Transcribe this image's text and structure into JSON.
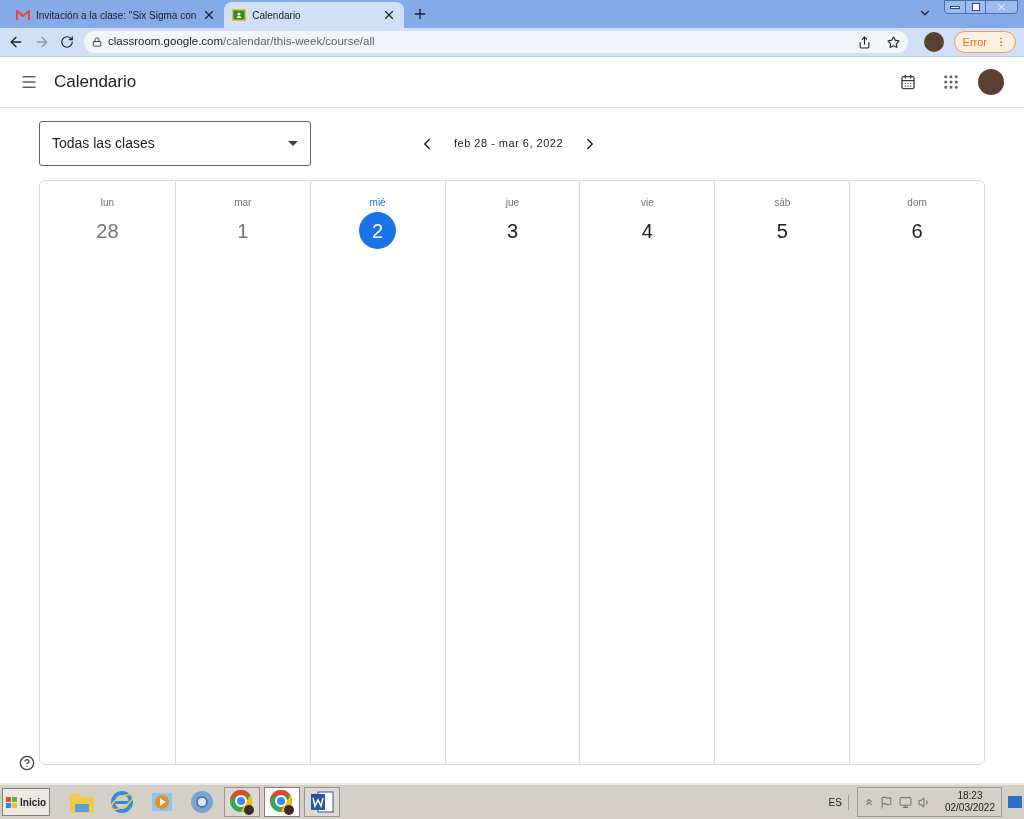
{
  "browser": {
    "tabs": [
      {
        "title": "Invitación a la clase: \"Six Sigma con",
        "kind": "mail",
        "selected": false
      },
      {
        "title": "Calendario",
        "kind": "classroom",
        "selected": true
      }
    ],
    "url_host": "classroom.google.com",
    "url_path": "/calendar/this-week/course/all",
    "profile_button": "Error"
  },
  "app": {
    "title": "Calendario"
  },
  "class_filter": {
    "value": "Todas las clases"
  },
  "week_range": "feb 28 - mar 6, 2022",
  "days": [
    {
      "weekday": "lun",
      "date": "28",
      "selected": false,
      "past": true
    },
    {
      "weekday": "mar",
      "date": "1",
      "selected": false,
      "past": true
    },
    {
      "weekday": "mié",
      "date": "2",
      "selected": true,
      "past": false
    },
    {
      "weekday": "jue",
      "date": "3",
      "selected": false,
      "past": false
    },
    {
      "weekday": "vie",
      "date": "4",
      "selected": false,
      "past": false
    },
    {
      "weekday": "sáb",
      "date": "5",
      "selected": false,
      "past": false
    },
    {
      "weekday": "dom",
      "date": "6",
      "selected": false,
      "past": false
    }
  ],
  "taskbar": {
    "start": "Inicio",
    "apps": [
      {
        "kind": "folder",
        "selected": false
      },
      {
        "kind": "ie",
        "selected": false
      },
      {
        "kind": "media",
        "selected": false
      },
      {
        "kind": "chromium",
        "selected": false
      },
      {
        "kind": "chrome",
        "selected": false
      },
      {
        "kind": "chrome",
        "selected": true
      },
      {
        "kind": "word",
        "selected": false
      }
    ],
    "language": "ES",
    "time": "18:23",
    "date": "02/03/2022"
  }
}
